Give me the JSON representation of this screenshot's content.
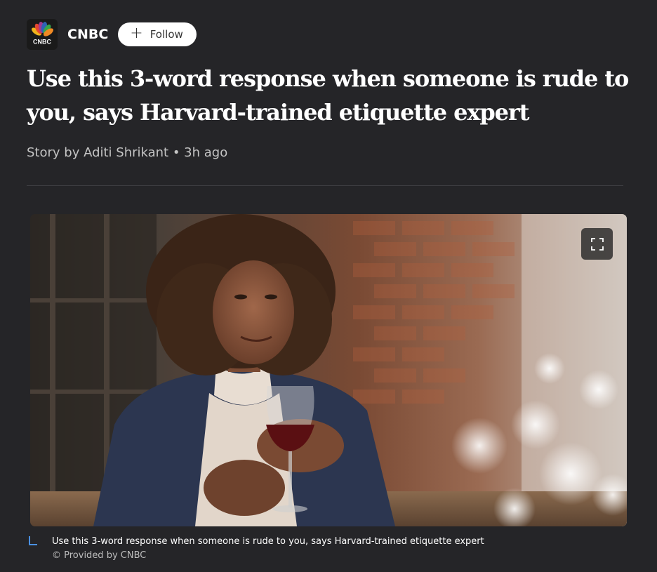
{
  "publisher": {
    "name": "CNBC",
    "logo_text": "CNBC",
    "follow_label": "Follow"
  },
  "article": {
    "headline": "Use this 3-word response when someone is rude to you, says Harvard-trained etiquette expert",
    "byline": "Story by Aditi Shrikant • 3h ago"
  },
  "image": {
    "caption": "Use this 3-word response when someone is rude to you, says Harvard-trained etiquette expert",
    "credit": "© Provided by CNBC"
  },
  "icons": {
    "logo": "cnbc-peacock-icon",
    "follow": "plus-icon",
    "expand": "expand-icon",
    "caption_marker": "caption-corner-icon"
  },
  "colors": {
    "background": "#252528",
    "follow_button_bg": "#ffffff",
    "caption_accent": "#4a90e2"
  }
}
